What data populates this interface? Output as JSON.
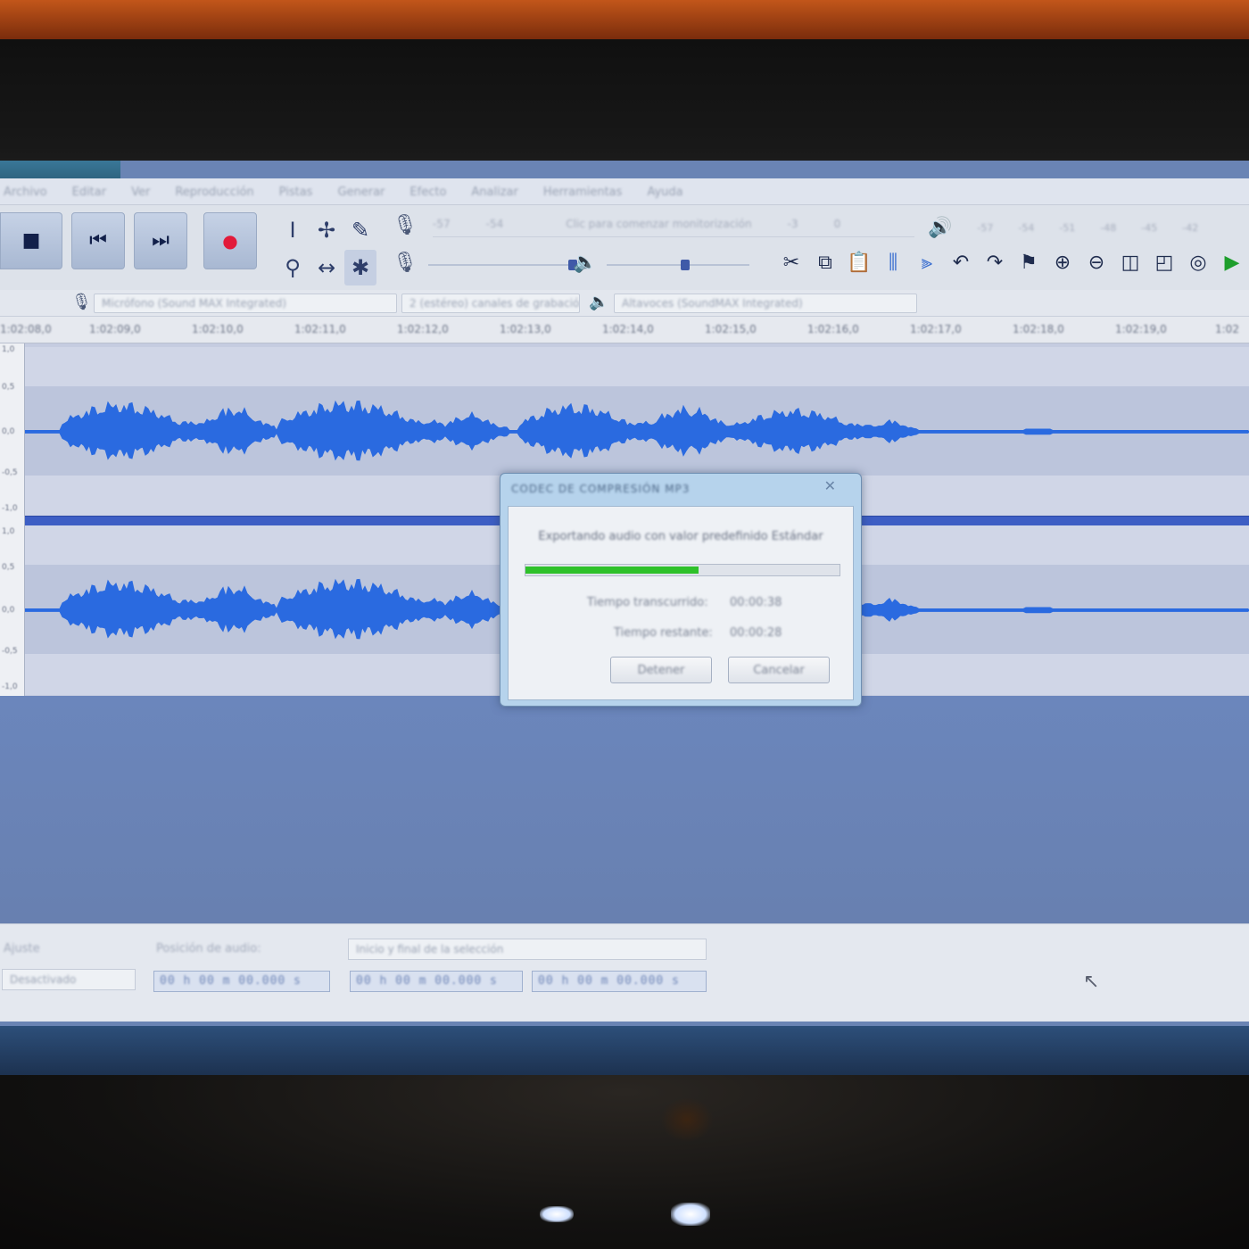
{
  "window": {
    "title": ""
  },
  "menu": {
    "items": [
      "Archivo",
      "Editar",
      "Ver",
      "Reproducción",
      "Pistas",
      "Generar",
      "Efecto",
      "Analizar",
      "Herramientas",
      "Ayuda"
    ]
  },
  "toolbar": {
    "transport": {
      "stop": "■",
      "skip_start": "⏮",
      "skip_end": "⏭",
      "record": "●"
    },
    "meter_hint": "Clic para comenzar monitorización",
    "meter_ticks": [
      "-57",
      "-54",
      "-51",
      "-48",
      "-45",
      "-42",
      "-3",
      "0"
    ],
    "right_ticks": [
      "-57",
      "-54",
      "-51",
      "-48",
      "-45",
      "-42"
    ],
    "input_volume": 0.95,
    "output_volume": 0.55
  },
  "devices": {
    "input_device": "Micrófono (Sound MAX Integrated)",
    "channels": "2 (estéreo) canales de grabación",
    "output_device": "Altavoces (SoundMAX Integrated)"
  },
  "ruler": {
    "labels": [
      "1:02:08,0",
      "1:02:09,0",
      "1:02:10,0",
      "1:02:11,0",
      "1:02:12,0",
      "1:02:13,0",
      "1:02:14,0",
      "1:02:15,0",
      "1:02:16,0",
      "1:02:17,0",
      "1:02:18,0",
      "1:02:19,0",
      "1:02"
    ]
  },
  "track": {
    "scale": [
      "1,0",
      "0,5",
      "0,0",
      "-0,5",
      "-1,0"
    ]
  },
  "dialog": {
    "title": "CODEC DE COMPRESIÓN MP3",
    "message": "Exportando audio con valor predefinido Estándar",
    "progress": 0.55,
    "elapsed_label": "Tiempo transcurrido:",
    "elapsed_value": "00:00:38",
    "remaining_label": "Tiempo restante:",
    "remaining_value": "00:00:28",
    "stop_label": "Detener",
    "cancel_label": "Cancelar"
  },
  "selection": {
    "project_rate_label": "Ajuste",
    "project_rate_value": "Desactivado",
    "position_label": "Posición de audio:",
    "position_value": "00 h 00 m 00.000 s",
    "range_mode": "Inicio y final de la selección",
    "start_value": "00 h 00 m 00.000 s",
    "end_value": "00 h 00 m 00.000 s"
  },
  "taskbar": {
    "apps": [
      {
        "icon": "media-player-icon",
        "glyph": "▶"
      },
      {
        "icon": "ie-icon",
        "glyph": "◉"
      },
      {
        "icon": "chrome-icon",
        "glyph": "◕"
      },
      {
        "icon": "folder-icon",
        "glyph": "▣"
      }
    ]
  },
  "colors": {
    "waveform": "#2a6ae0",
    "progress": "#2ec12a",
    "record": "#e21a3a"
  }
}
